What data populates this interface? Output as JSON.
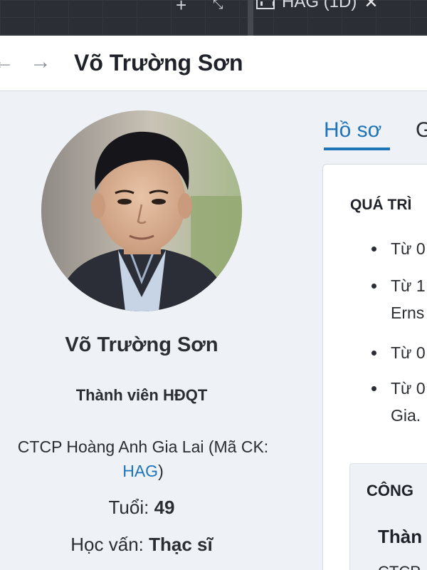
{
  "tabstrip": {
    "plus_icon": "plus-icon",
    "collapse_icon": "collapse-icon",
    "active_tab_label": "HAG (1D)",
    "close_glyph": "✕"
  },
  "header": {
    "back_glyph": "←",
    "forward_glyph": "→",
    "title": "Võ Trường Sơn"
  },
  "profile": {
    "name": "Võ Trường Sơn",
    "role": "Thành viên HĐQT",
    "company_prefix": "CTCP Hoàng Anh Gia Lai (Mã CK:",
    "ticker": "HAG",
    "company_suffix": ")",
    "age_label": "Tuổi:",
    "age_value": "49",
    "education_label": "Học vấn:",
    "education_value": "Thạc sĩ"
  },
  "tabs": {
    "profile_label": "Hồ sơ",
    "other_label": "G"
  },
  "career": {
    "title": "QUÁ TRÌ",
    "items": [
      {
        "text": "Từ 0",
        "sub": ""
      },
      {
        "text": "Từ 1",
        "sub": "Erns"
      },
      {
        "text": "Từ 0",
        "sub": ""
      },
      {
        "text": "Từ 0",
        "sub": "Gia."
      }
    ]
  },
  "company_section": {
    "title": "CÔNG",
    "member_label": "Thàn",
    "sub_label": "CTCP"
  },
  "colors": {
    "accent": "#1f74b8",
    "tabstrip_bg": "#2b2f35",
    "page_bg": "#eef2f7"
  }
}
